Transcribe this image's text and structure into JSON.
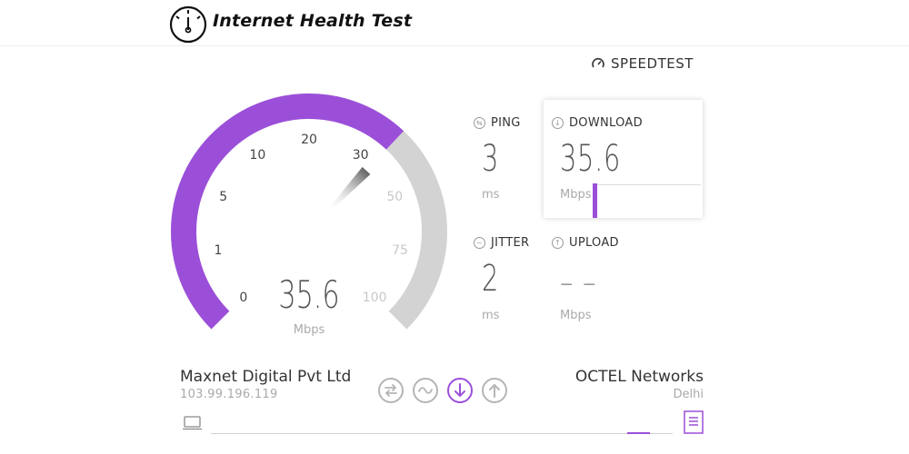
{
  "header": {
    "title": "Internet Health Test",
    "logo_icon": "speedometer-icon"
  },
  "brand": {
    "label": "SPEEDTEST",
    "icon": "speedtest-gauge-icon"
  },
  "gauge": {
    "value": "35.6",
    "unit": "Mbps",
    "scale_labels": [
      "0",
      "1",
      "5",
      "10",
      "20",
      "30",
      "50",
      "75",
      "100"
    ],
    "needle_value_mbps": 35.6,
    "accent_color": "#9b4fd9",
    "track_color": "#d3d3d3"
  },
  "metrics": {
    "ping": {
      "label": "PING",
      "value": "3",
      "unit": "ms",
      "icon": "ping-icon"
    },
    "download": {
      "label": "DOWNLOAD",
      "value": "35.6",
      "unit": "Mbps",
      "icon": "download-arrow-icon"
    },
    "jitter": {
      "label": "JITTER",
      "value": "2",
      "unit": "ms",
      "icon": "jitter-icon"
    },
    "upload": {
      "label": "UPLOAD",
      "value": "– –",
      "unit": "Mbps",
      "icon": "upload-arrow-icon"
    }
  },
  "isp": {
    "name": "Maxnet Digital Pvt Ltd",
    "ip": "103.99.196.119"
  },
  "server": {
    "name": "OCTEL Networks",
    "location": "Delhi"
  },
  "stages": [
    {
      "name": "ping-stage-icon",
      "active": false
    },
    {
      "name": "jitter-stage-icon",
      "active": false
    },
    {
      "name": "download-stage-icon",
      "active": true
    },
    {
      "name": "upload-stage-icon",
      "active": false
    }
  ],
  "progress": {
    "fraction": 0.95
  }
}
